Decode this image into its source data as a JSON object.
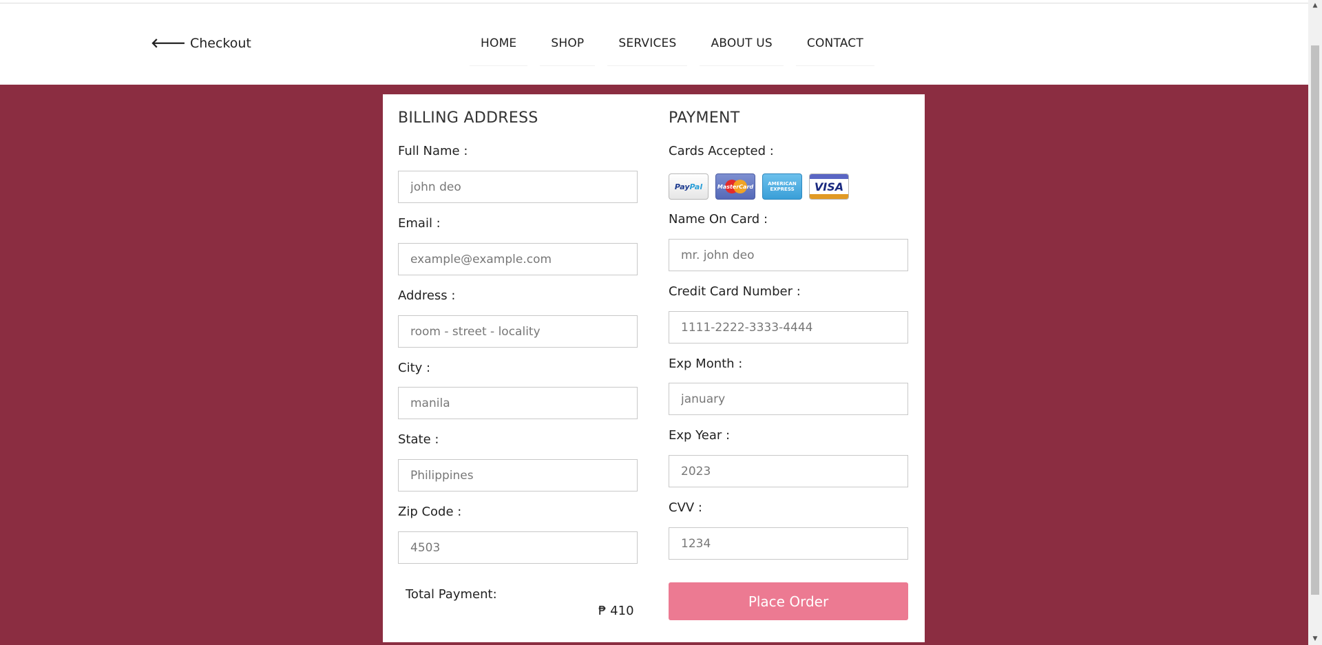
{
  "header": {
    "back_label": "Checkout",
    "nav": [
      "HOME",
      "SHOP",
      "SERVICES",
      "ABOUT US",
      "CONTACT"
    ]
  },
  "billing": {
    "title": "BILLING ADDRESS",
    "fields": [
      {
        "label": "Full Name :",
        "placeholder": "john deo"
      },
      {
        "label": "Email :",
        "placeholder": "example@example.com"
      },
      {
        "label": "Address :",
        "placeholder": "room - street - locality"
      },
      {
        "label": "City :",
        "placeholder": "manila"
      },
      {
        "label": "State :",
        "placeholder": "Philippines"
      },
      {
        "label": "Zip Code :",
        "placeholder": "4503"
      }
    ],
    "total_label": "Total Payment:",
    "total_value": "₱ 410"
  },
  "payment": {
    "title": "PAYMENT",
    "cards_label": "Cards Accepted :",
    "cards": [
      "paypal-icon",
      "mastercard-icon",
      "american-express-icon",
      "visa-icon"
    ],
    "fields": [
      {
        "label": "Name On Card :",
        "placeholder": "mr. john deo"
      },
      {
        "label": "Credit Card Number :",
        "placeholder": "1111-2222-3333-4444"
      },
      {
        "label": "Exp Month :",
        "placeholder": "january"
      },
      {
        "label": "Exp Year :",
        "placeholder": "2023"
      },
      {
        "label": "CVV :",
        "placeholder": "1234"
      }
    ],
    "submit_label": "Place Order"
  },
  "colors": {
    "background": "#8b2d41",
    "button": "#ec7a92"
  }
}
